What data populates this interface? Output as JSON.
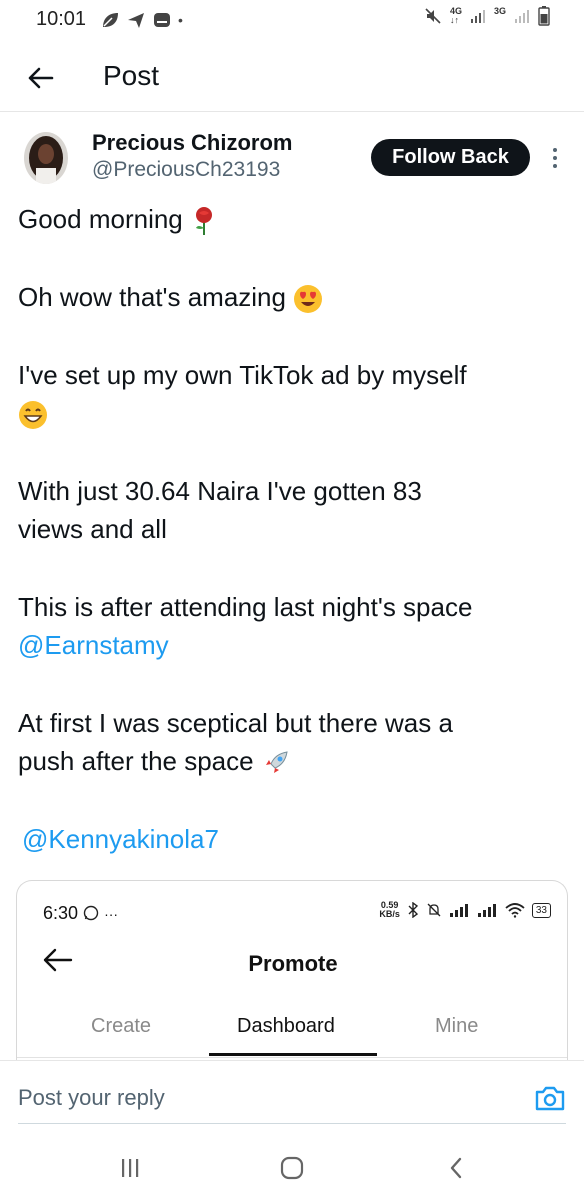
{
  "status_bar": {
    "time": "10:01",
    "dot": "•",
    "net1": "4G",
    "net2": "3G",
    "icons": [
      "leaf-icon",
      "send-icon",
      "message-icon",
      "mute-icon",
      "signal-icon",
      "battery-icon"
    ]
  },
  "header": {
    "title": "Post",
    "back_icon": "arrow-left-icon"
  },
  "author": {
    "name": "Precious Chizorom",
    "handle": "@PreciousCh23193",
    "follow_label": "Follow Back",
    "more_icon": "more-vertical-icon"
  },
  "post": {
    "lines": [
      "Good morning",
      "Oh wow that's amazing",
      "I've set up my own TikTok ad by myself",
      "With just 30.64 Naira I've gotten 83",
      "views and all",
      "This is after attending last night's space",
      "@Earnstamy",
      "At first I was sceptical but there was a",
      "push after the space",
      "@Kennyakinola7"
    ],
    "emojis": [
      "rose",
      "heart-eyes",
      "grin",
      "rocket"
    ]
  },
  "embed": {
    "time": "6:30",
    "more": "···",
    "speed_value": "0.59",
    "speed_unit": "KB/s",
    "battery": "33",
    "title": "Promote",
    "tabs": [
      "Create",
      "Dashboard",
      "Mine"
    ],
    "active_tab": "Dashboard"
  },
  "reply": {
    "placeholder": "Post your reply",
    "camera_icon": "camera-icon"
  },
  "nav": {
    "icons": [
      "recents-icon",
      "home-icon",
      "back-chevron-icon"
    ]
  },
  "colors": {
    "link": "#1d9bf0",
    "text": "#0f1419",
    "secondary": "#536471",
    "follow_bg": "#0f1419"
  }
}
